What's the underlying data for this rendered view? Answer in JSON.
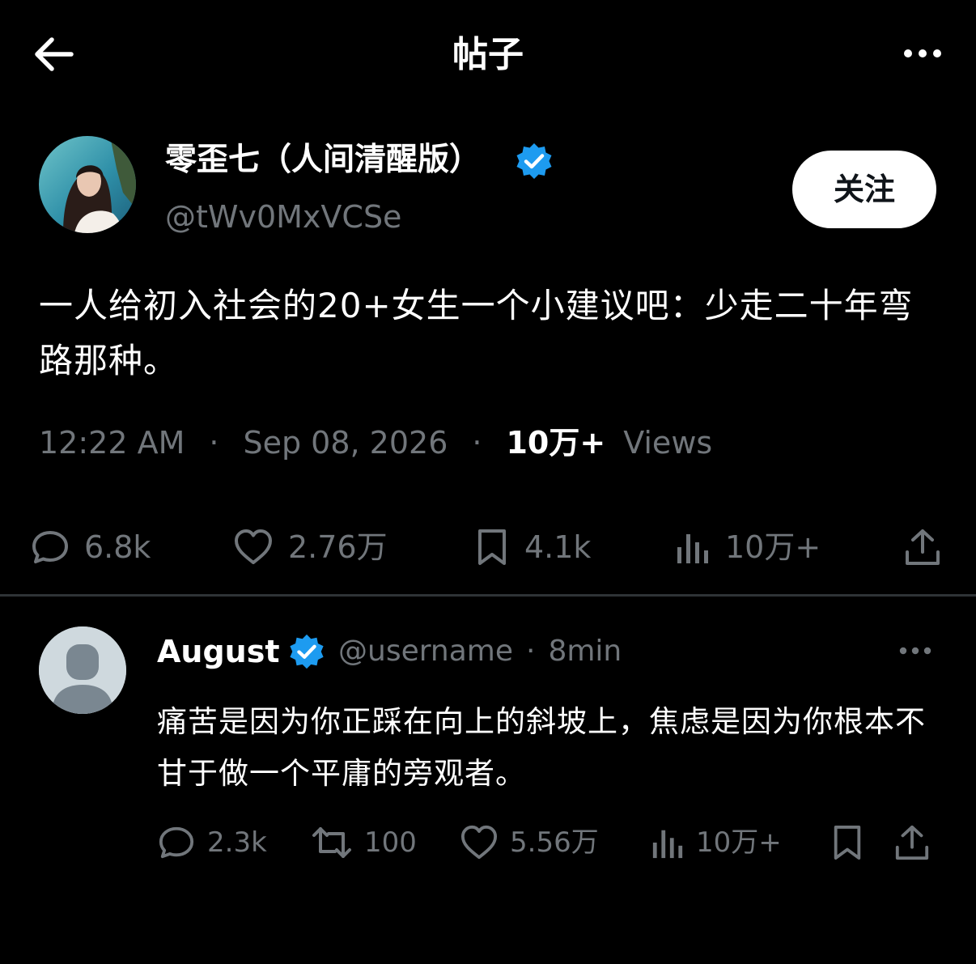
{
  "header": {
    "title": "帖子",
    "back_icon": "arrow-left-icon",
    "more_icon": "more-horizontal-icon"
  },
  "post": {
    "author_name": "零歪七（人间清醒版）",
    "author_handle": "@tWv0MxVCSe",
    "verified": true,
    "follow_label": "关注",
    "text": "一人给初入社会的20+女生一个小建议吧：少走二十年弯路那种。",
    "time": "12:22 AM",
    "date": "Sep 08, 2026",
    "views_count": "10万+",
    "views_label": "Views",
    "actions": {
      "replies": "6.8k",
      "likes": "2.76万",
      "bookmarks": "4.1k",
      "views": "10万+"
    }
  },
  "reply": {
    "name": "August",
    "handle": "@username",
    "separator": "·",
    "time": "8min",
    "verified": true,
    "text": "痛苦是因为你正踩在向上的斜坡上，焦虑是因为你根本不甘于做一个平庸的旁观者。",
    "actions": {
      "replies": "2.3k",
      "reposts": "100",
      "likes": "5.56万",
      "views": "10万+"
    }
  },
  "colors": {
    "background": "#000000",
    "text": "#ffffff",
    "secondary": "#71767b",
    "verified": "#1d9bf0",
    "divider": "#2f3336"
  }
}
